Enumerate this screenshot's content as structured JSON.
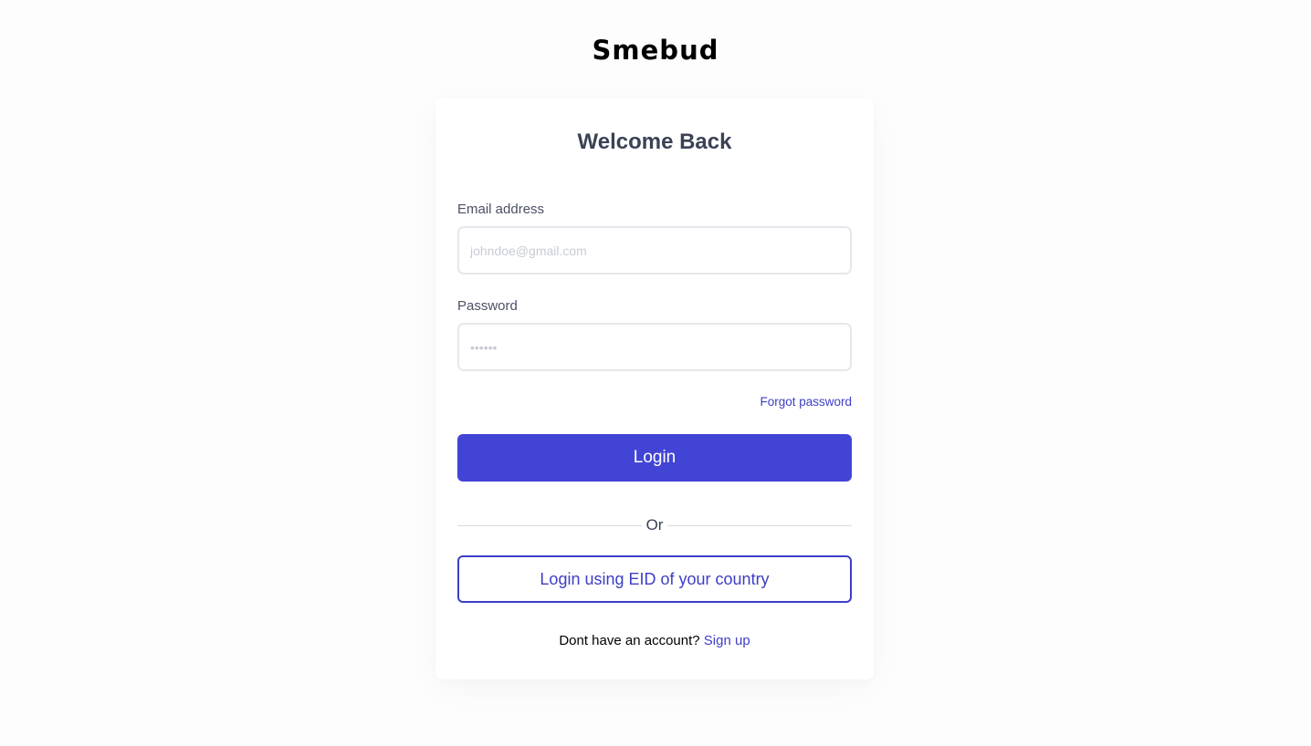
{
  "brand": {
    "name": "Smebud"
  },
  "login_card": {
    "title": "Welcome Back",
    "email": {
      "label": "Email address",
      "value": "",
      "placeholder": "johndoe@gmail.com"
    },
    "password": {
      "label": "Password",
      "value": "",
      "placeholder": "••••••"
    },
    "forgot_password_label": "Forgot password",
    "login_button_label": "Login",
    "divider_label": "Or",
    "eid_button_label": "Login using EID of your country",
    "signup_prompt": "Dont have an account?",
    "signup_link_label": "Sign up"
  },
  "colors": {
    "accent": "#4244d6",
    "link": "#3d3ec5",
    "heading": "#3b4256",
    "background": "#fdfdfd"
  }
}
